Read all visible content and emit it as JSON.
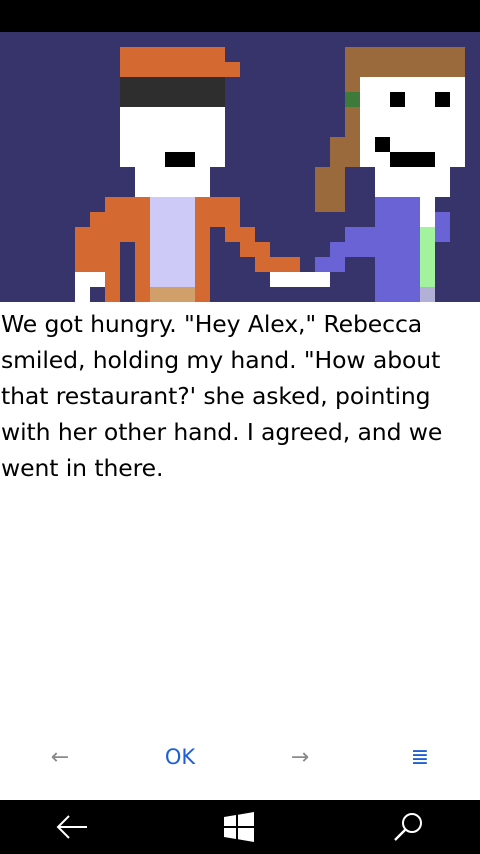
{
  "story": {
    "text": "We got hungry. \"Hey Alex,\" Rebecca smiled, holding my hand. \"How about that restaurant?' she asked, pointing with her other hand. I agreed, and we went in there."
  },
  "controls": {
    "back_icon": "left-arrow-icon",
    "back_glyph": "←",
    "ok_label": "OK",
    "next_icon": "right-arrow-icon",
    "next_glyph": "→",
    "menu_icon": "menu-icon",
    "menu_glyph": "≣"
  },
  "system_nav": {
    "back_icon": "back-icon",
    "home_icon": "windows-logo-icon",
    "search_icon": "search-icon"
  },
  "colors": {
    "scene_background": "#36346b",
    "accent": "#1e5fd8",
    "alex_cap": "#d46a32",
    "alex_jacket": "#d46a32",
    "alex_shirt": "#cdcaf7",
    "rebecca_hair": "#9a6a3c",
    "rebecca_top": "#6a63d6",
    "rebecca_shirt": "#a3f29e"
  }
}
